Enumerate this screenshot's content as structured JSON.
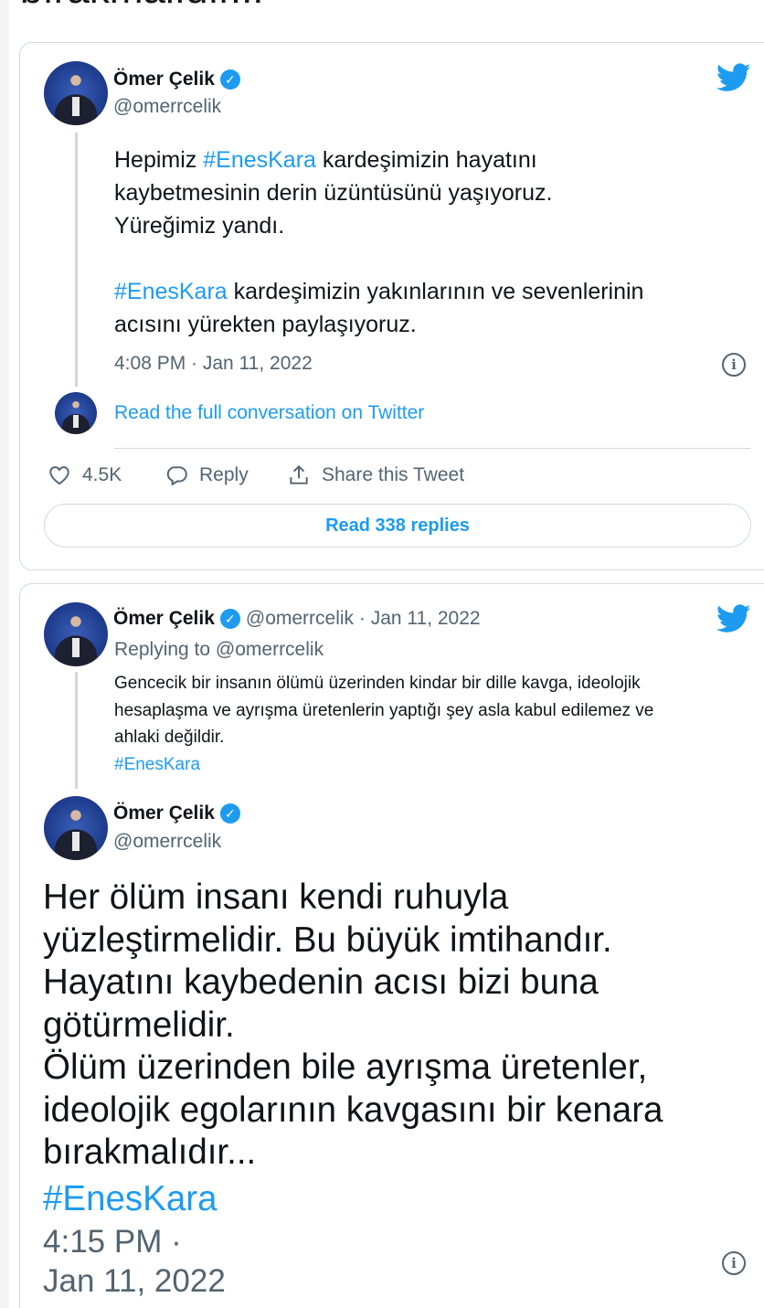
{
  "top_cut_text": "bırakmalıdır...",
  "tweet1": {
    "name": "Ömer Çelik",
    "handle": "@omerrcelik",
    "verified_mark": "✓",
    "body_line1_pre": "Hepimiz ",
    "body_hashtag1": "#EnesKara",
    "body_line1_post": " kardeşimizin hayatını\nkaybetmesinin derin üzüntüsünü yaşıyoruz.\nYüreğimiz yandı.",
    "body_hashtag2": "#EnesKara",
    "body_para2_post": " kardeşimizin yakınlarının ve sevenlerinin\nacısını yürekten paylaşıyoruz.",
    "timestamp": "4:08 PM · Jan 11, 2022",
    "info_icon": "i",
    "read_full_link": "Read the full conversation on Twitter",
    "like_count": "4.5K",
    "reply_label": "Reply",
    "share_label": "Share this Tweet",
    "read_replies_label": "Read 338 replies"
  },
  "tweet2_parent": {
    "name": "Ömer Çelik",
    "verified_mark": "✓",
    "handle_and_date": "@omerrcelik · Jan 11, 2022",
    "replying_prefix": "Replying to ",
    "replying_handle": "@omerrcelik",
    "body": "Gencecik bir insanın ölümü üzerinden kindar bir dille kavga, ideolojik\nhesaplaşma ve ayrışma üretenlerin yaptığı şey asla kabul edilemez ve\nahlaki değildir.",
    "hashtag": "#EnesKara"
  },
  "tweet2_main": {
    "name": "Ömer Çelik",
    "verified_mark": "✓",
    "handle": "@omerrcelik",
    "body": "Her ölüm insanı kendi ruhuyla\nyüzleştirmelidir. Bu büyük imtihandır.\nHayatını kaybedenin acısı bizi buna\ngötürmelidir.\nÖlüm üzerinden bile ayrışma üretenler,\nideolojik egolarının kavgasını bir kenara\nbırakmalıdır...",
    "hashtag": "#EnesKara",
    "time": "4:15 PM ·",
    "date": "Jan 11, 2022",
    "info_icon": "i"
  },
  "colors": {
    "accent": "#1d9bf0",
    "text": "#0f1419",
    "secondary": "#536471",
    "border": "#cfd9de"
  }
}
